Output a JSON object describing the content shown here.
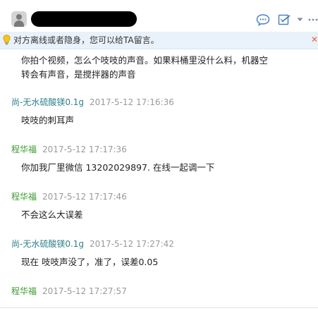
{
  "header": {
    "avatar_icon": "default-avatar-icon",
    "name_redacted": true,
    "actions": [
      {
        "icon": "chat-bubble-icon"
      },
      {
        "icon": "edit-note-icon"
      },
      {
        "icon": "chevron-down-icon"
      },
      {
        "icon": "more-icon",
        "label": "···"
      }
    ]
  },
  "notice": {
    "icon": "lightbulb-icon",
    "text": "对方离线或者隐身，您可以给TA留言。",
    "close_label": "✕"
  },
  "colors": {
    "sender_a": "#2f7f8c",
    "sender_b": "#3b9a2f",
    "timestamp": "#9a9a9a",
    "notice_bg": "#e9f1fa"
  },
  "messages": [
    {
      "lines": [
        "你拍个视频，怎么个吱吱的声音。如果料桶里没什么料，机器空",
        "转会有声音，是搅拌器的声音"
      ]
    },
    {
      "sender": "尚-无水硫酸镁0.1g",
      "time": "2017-5-12 17:16:36",
      "lines": [
        "吱吱的刺耳声"
      ]
    },
    {
      "sender": "程华福",
      "time": "2017-5-12 17:17:36",
      "lines": [
        "你加我厂里微信 13202029897. 在线一起调一下"
      ]
    },
    {
      "sender": "程华福",
      "time": "2017-5-12 17:17:46",
      "lines": [
        "不会这么大误差"
      ]
    },
    {
      "sender": "尚-无水硫酸镁0.1g",
      "time": "2017-5-12 17:27:42",
      "lines": [
        "现在 吱吱声没了，准了，误差0.05"
      ]
    },
    {
      "sender": "程华福",
      "time": "2017-5-12 17:27:57",
      "lines": []
    }
  ]
}
